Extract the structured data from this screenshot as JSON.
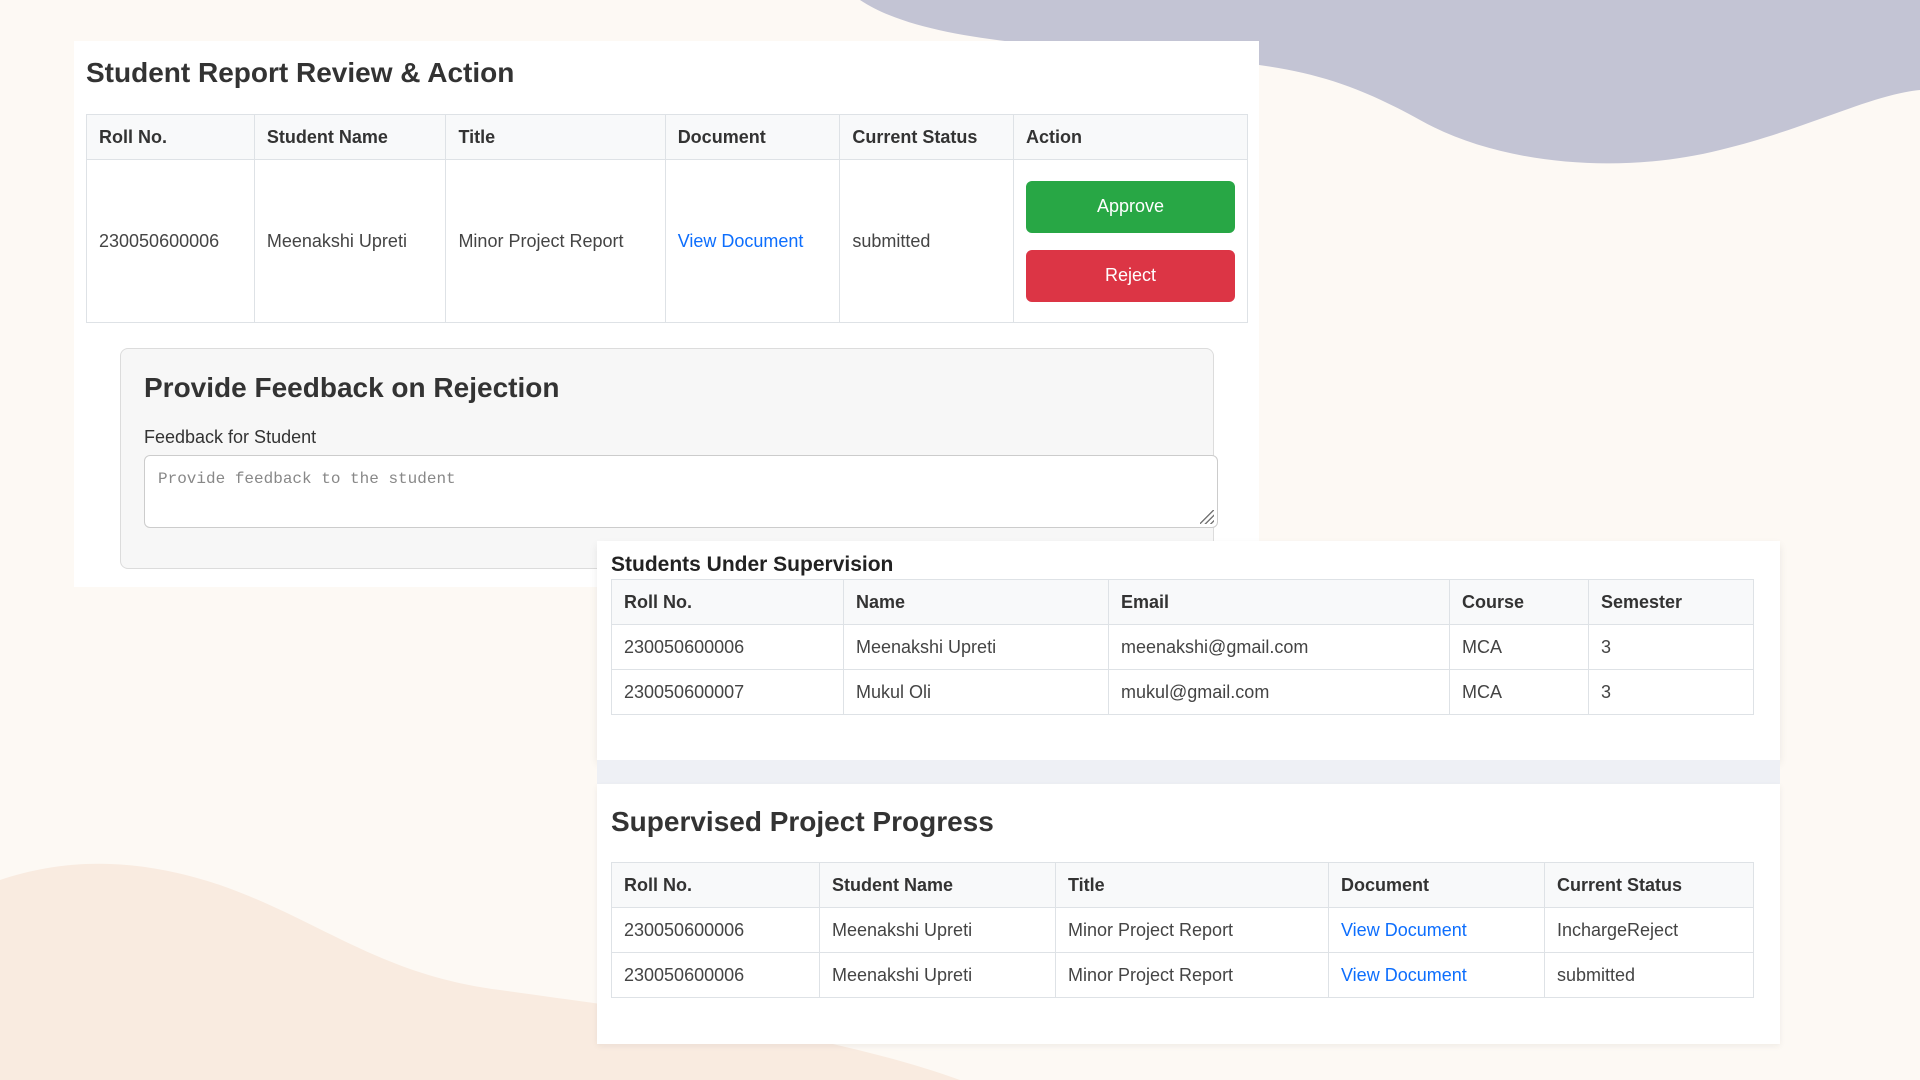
{
  "review": {
    "heading": "Student Report Review & Action",
    "columns": [
      "Roll No.",
      "Student Name",
      "Title",
      "Document",
      "Current Status",
      "Action"
    ],
    "row": {
      "roll_no": "230050600006",
      "student_name": "Meenakshi Upreti",
      "title": "Minor Project Report",
      "document_link": "View Document",
      "status": "submitted",
      "approve_label": "Approve",
      "reject_label": "Reject"
    }
  },
  "feedback": {
    "heading": "Provide Feedback on Rejection",
    "label": "Feedback for Student",
    "placeholder": "Provide feedback to the student"
  },
  "supervision": {
    "heading": "Students Under Supervision",
    "columns": [
      "Roll No.",
      "Name",
      "Email",
      "Course",
      "Semester"
    ],
    "rows": [
      [
        "230050600006",
        "Meenakshi Upreti",
        "meenakshi@gmail.com",
        "MCA",
        "3"
      ],
      [
        "230050600007",
        "Mukul Oli",
        "mukul@gmail.com",
        "MCA",
        "3"
      ]
    ]
  },
  "progress": {
    "heading": "Supervised Project Progress",
    "columns": [
      "Roll No.",
      "Student Name",
      "Title",
      "Document",
      "Current Status"
    ],
    "rows": [
      [
        "230050600006",
        "Meenakshi Upreti",
        "Minor Project Report",
        "View Document",
        "InchargeReject"
      ],
      [
        "230050600006",
        "Meenakshi Upreti",
        "Minor Project Report",
        "View Document",
        "submitted"
      ]
    ]
  },
  "colors": {
    "approve": "#28a745",
    "reject": "#dc3545",
    "link": "#0d6efd",
    "background": "#fdf9f4",
    "blob_top": "#c3c4d4",
    "blob_bottom": "#f9ebe0"
  }
}
